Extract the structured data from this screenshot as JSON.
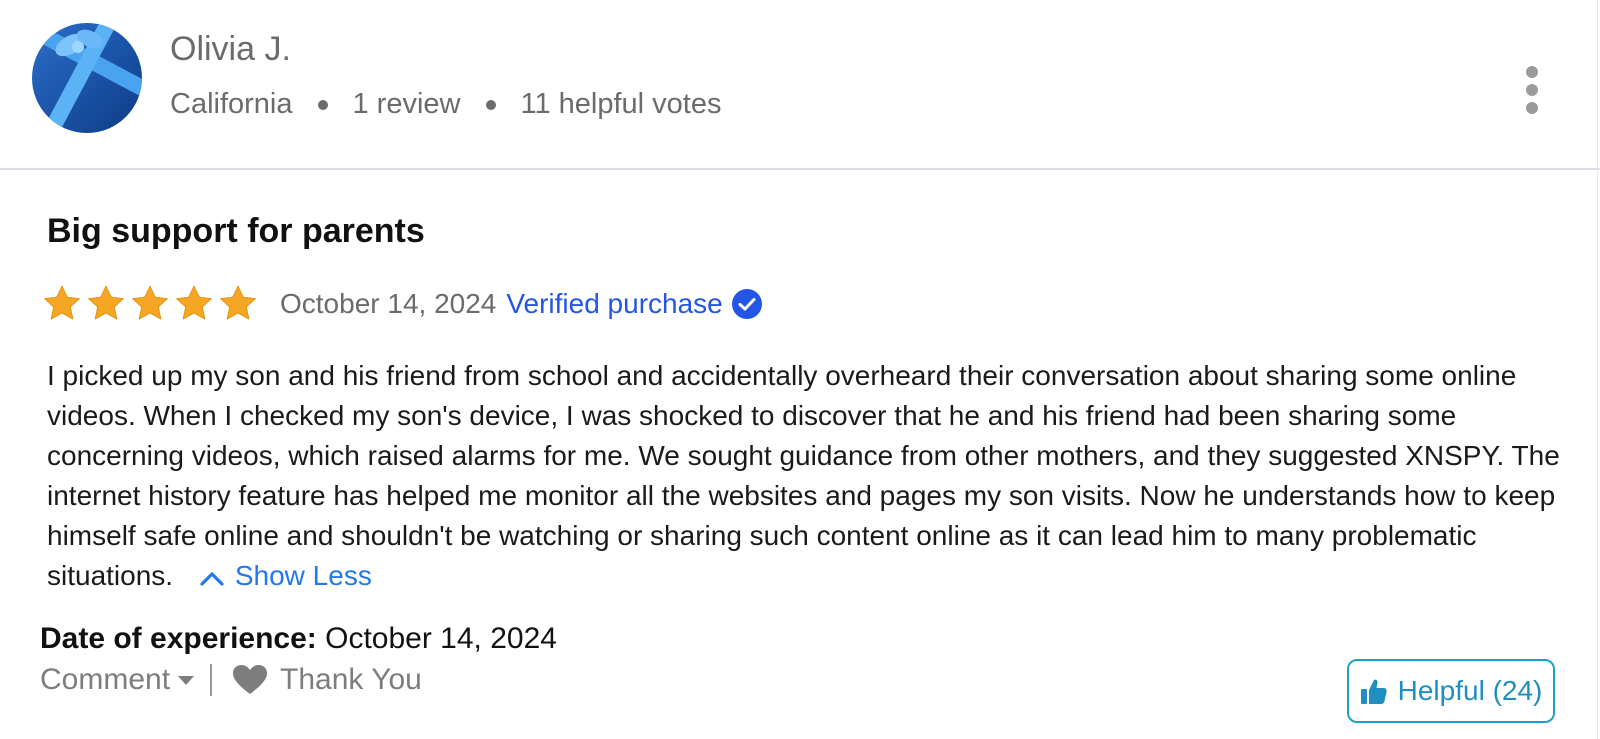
{
  "reviewer": {
    "name": "Olivia J.",
    "location": "California",
    "review_count": "1 review",
    "helpful_votes": "11 helpful votes",
    "avatar_icon": "gift-box-avatar"
  },
  "review": {
    "title": "Big support for parents",
    "rating": 5,
    "rating_max": 5,
    "date": "October 14, 2024",
    "verified_label": "Verified purchase",
    "body": "I picked up my son and his friend from school and accidentally overheard their conversation about  sharing some online videos. When I checked my son's device, I was shocked to discover that he and his friend had been sharing some concerning videos, which raised alarms for me. We sought guidance from other mothers, and they suggested XNSPY. The internet history feature has helped me monitor all the websites and pages my son visits. Now he understands how to keep himself safe online and shouldn't be watching or sharing such content online as it can lead him to many problematic situations.",
    "show_less_label": "Show Less",
    "date_of_experience_label": "Date of experience:",
    "date_of_experience_value": "October 14, 2024"
  },
  "actions": {
    "comment_label": "Comment",
    "thank_you_label": "Thank You",
    "helpful_label": "Helpful (24)"
  },
  "colors": {
    "star": "#f5a623",
    "link_blue": "#2456e6",
    "helpful_accent": "#1f8fbf",
    "muted_text": "#6b6b6b"
  }
}
